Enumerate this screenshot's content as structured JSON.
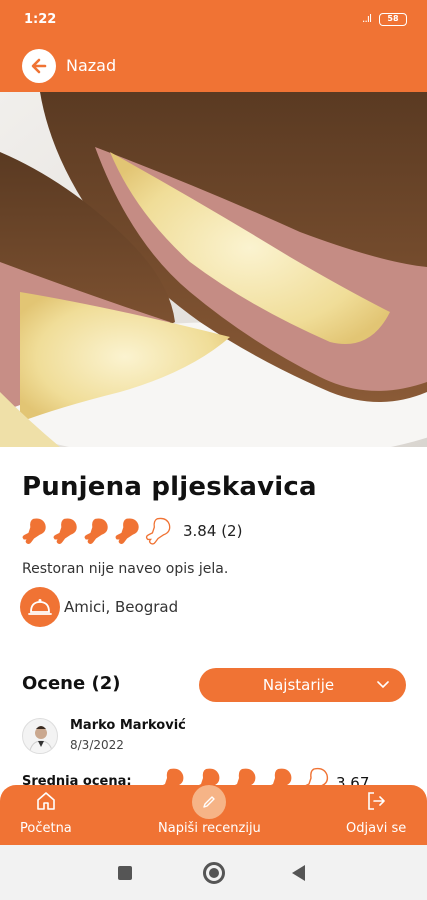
{
  "status": {
    "time": "1:22",
    "signal": "..ıl",
    "battery": "58"
  },
  "header": {
    "back_label": "Nazad"
  },
  "dish": {
    "title": "Punjena pljeskavica",
    "rating_value": "3.84",
    "rating_count": "(2)",
    "rating_fraction": 0.768,
    "description": "Restoran nije naveo opis jela.",
    "restaurant": "Amici, Beograd"
  },
  "reviews": {
    "title": "Ocene (2)",
    "sort_label": "Najstarije",
    "items": [
      {
        "name": "Marko Marković",
        "date": "8/3/2022",
        "avg_label": "Srednja ocena:",
        "avg_value": "3.67"
      }
    ]
  },
  "nav": {
    "home": "Početna",
    "write": "Napiši recenziju",
    "logout": "Odjavi se"
  },
  "colors": {
    "accent": "#f07334",
    "accent_light": "#f6b487"
  },
  "icons": [
    "arrow-left-icon",
    "drumstick-icon",
    "cloche-icon",
    "chevron-down-icon",
    "home-icon",
    "pencil-icon",
    "logout-icon"
  ]
}
